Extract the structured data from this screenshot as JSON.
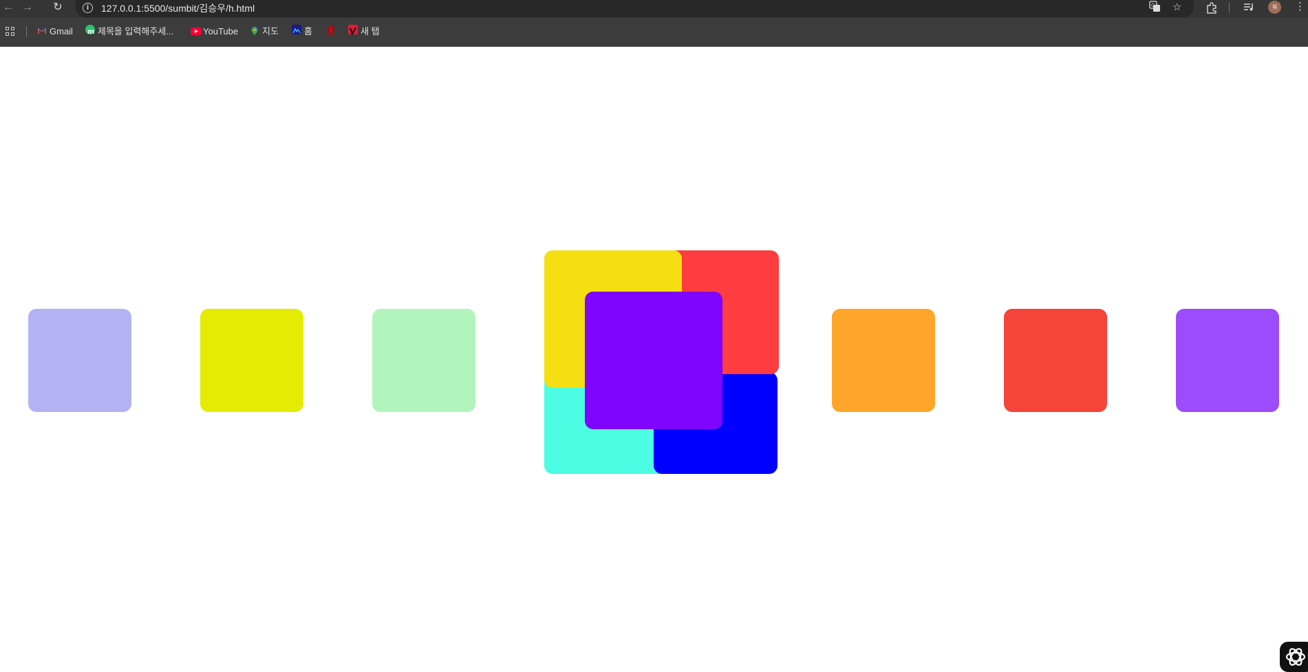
{
  "browser": {
    "url": "127.0.0.1:5500/sumbit/김승우/h.html",
    "nav": {
      "back": "←",
      "forward": "→",
      "reload": "↻"
    },
    "icons": {
      "translate": "translate-icon",
      "bookmark_star": "star-icon",
      "extensions": "puzzle-icon",
      "media": "media-queue-icon",
      "menu": "kebab-menu-icon"
    },
    "avatar_text": "워"
  },
  "bookmarks": [
    {
      "label": "Gmail",
      "icon": "gmail-icon",
      "color": "#ea4335"
    },
    {
      "label": "제목을 입력해주세...",
      "icon": "m-site-icon",
      "color": "#2bc46f"
    },
    {
      "label": "YouTube",
      "icon": "youtube-icon",
      "color": "#ff0033"
    },
    {
      "label": "지도",
      "icon": "maps-pin-icon",
      "color": "#34a853"
    },
    {
      "label": "홈",
      "icon": "home-site-icon",
      "color": "#1a73e8"
    },
    {
      "label": "",
      "icon": "netflix-icon",
      "color": "#e50914"
    },
    {
      "label": "새 탭",
      "icon": "new-tab-site-icon",
      "color": "#e8173a"
    }
  ],
  "squares": {
    "row": [
      {
        "name": "lavender-square",
        "color": "#b3b3f3"
      },
      {
        "name": "yellow-square",
        "color": "#e6eb04"
      },
      {
        "name": "mint-square",
        "color": "#b2f5bc"
      },
      {
        "name": "orange-square",
        "color": "#ffa62a"
      },
      {
        "name": "red-square",
        "color": "#f54439"
      },
      {
        "name": "violet-square",
        "color": "#9c4cfc"
      }
    ],
    "center": [
      {
        "name": "center-cyan-square",
        "color": "#4cfde4"
      },
      {
        "name": "center-blue-square",
        "color": "#0000fe"
      },
      {
        "name": "center-red-square",
        "color": "#ff3c3f"
      },
      {
        "name": "center-yellow-square",
        "color": "#f5de12"
      },
      {
        "name": "center-purple-square",
        "color": "#7f05fe"
      }
    ]
  }
}
